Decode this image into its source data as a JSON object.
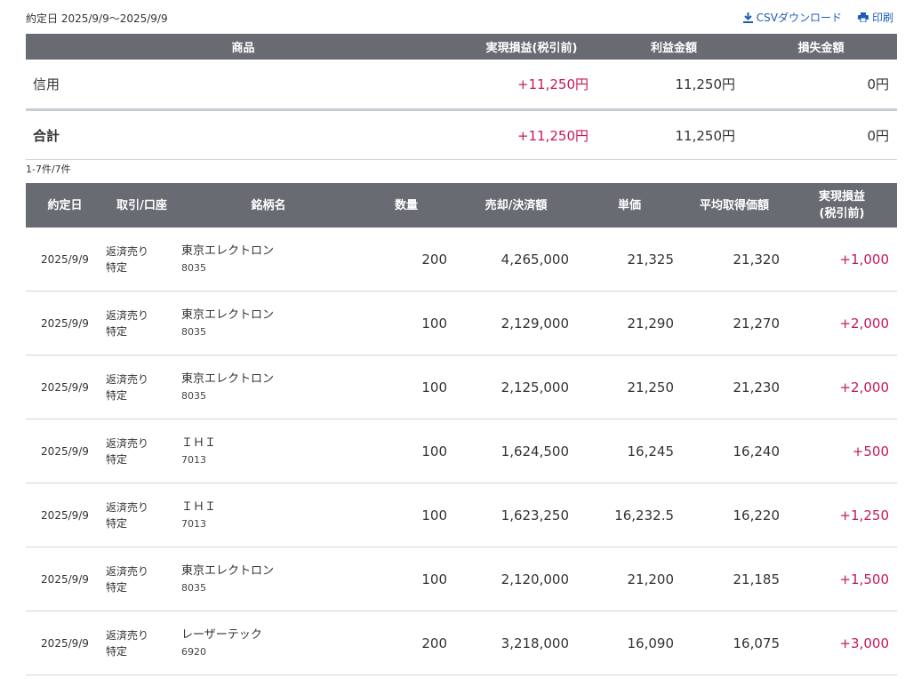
{
  "header": {
    "date_range": "約定日 2025/9/9〜2025/9/9",
    "csv_label": "CSVダウンロード",
    "print_label": "印刷"
  },
  "summary": {
    "columns": [
      "商品",
      "実現損益(税引前)",
      "利益金額",
      "損失金額"
    ],
    "rows": [
      {
        "product": "信用",
        "realized": "+11,250円",
        "profit": "11,250円",
        "loss": "0円"
      }
    ],
    "total": {
      "product": "合計",
      "realized": "+11,250円",
      "profit": "11,250円",
      "loss": "0円"
    }
  },
  "count_text": "1-7件/7件",
  "list": {
    "columns": {
      "date": "約定日",
      "account": "取引/口座",
      "name": "銘柄名",
      "qty": "数量",
      "amount": "売却/決済額",
      "price": "単価",
      "avg": "平均取得価額",
      "pl_line1": "実現損益",
      "pl_line2": "(税引前)"
    },
    "rows": [
      {
        "date": "2025/9/9",
        "trade": "返済売り",
        "account": "特定",
        "name": "東京エレクトロン",
        "code": "8035",
        "qty": "200",
        "amount": "4,265,000",
        "price": "21,325",
        "avg": "21,320",
        "pl": "+1,000"
      },
      {
        "date": "2025/9/9",
        "trade": "返済売り",
        "account": "特定",
        "name": "東京エレクトロン",
        "code": "8035",
        "qty": "100",
        "amount": "2,129,000",
        "price": "21,290",
        "avg": "21,270",
        "pl": "+2,000"
      },
      {
        "date": "2025/9/9",
        "trade": "返済売り",
        "account": "特定",
        "name": "東京エレクトロン",
        "code": "8035",
        "qty": "100",
        "amount": "2,125,000",
        "price": "21,250",
        "avg": "21,230",
        "pl": "+2,000"
      },
      {
        "date": "2025/9/9",
        "trade": "返済売り",
        "account": "特定",
        "name": "ＩＨＩ",
        "code": "7013",
        "qty": "100",
        "amount": "1,624,500",
        "price": "16,245",
        "avg": "16,240",
        "pl": "+500"
      },
      {
        "date": "2025/9/9",
        "trade": "返済売り",
        "account": "特定",
        "name": "ＩＨＩ",
        "code": "7013",
        "qty": "100",
        "amount": "1,623,250",
        "price": "16,232.5",
        "avg": "16,220",
        "pl": "+1,250"
      },
      {
        "date": "2025/9/9",
        "trade": "返済売り",
        "account": "特定",
        "name": "東京エレクトロン",
        "code": "8035",
        "qty": "100",
        "amount": "2,120,000",
        "price": "21,200",
        "avg": "21,185",
        "pl": "+1,500"
      },
      {
        "date": "2025/9/9",
        "trade": "返済売り",
        "account": "特定",
        "name": "レーザーテック",
        "code": "6920",
        "qty": "200",
        "amount": "3,218,000",
        "price": "16,090",
        "avg": "16,075",
        "pl": "+3,000"
      }
    ]
  },
  "colors": {
    "header_bg": "#686c72",
    "plus": "#c6185b",
    "link": "#1e5bb8"
  }
}
